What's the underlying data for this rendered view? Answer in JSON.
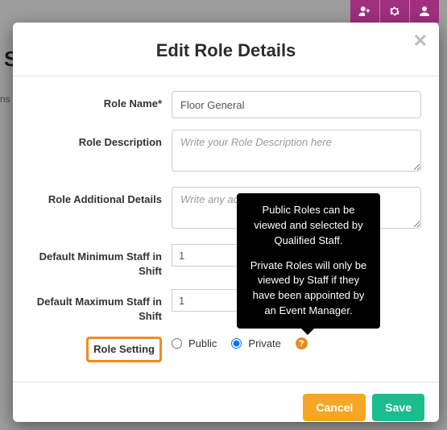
{
  "header": {
    "title": "Edit Role Details"
  },
  "fields": {
    "role_name": {
      "label": "Role Name*",
      "value": "Floor General"
    },
    "role_desc": {
      "label": "Role Description",
      "placeholder": "Write your Role Description here"
    },
    "role_add": {
      "label": "Role Additional Details",
      "placeholder": "Write any additional Role Description here"
    },
    "min_staff": {
      "label": "Default Minimum Staff in Shift",
      "value": "1"
    },
    "max_staff": {
      "label": "Default Maximum Staff in Shift",
      "value": "1"
    },
    "setting": {
      "label": "Role Setting",
      "public": "Public",
      "private": "Private"
    }
  },
  "tooltip": {
    "p1": "Public Roles can be viewed and selected by Qualified Staff.",
    "p2": "Private Roles will only be viewed by Staff if they have been appointed by an Event Manager."
  },
  "footer": {
    "cancel": "Cancel",
    "save": "Save"
  },
  "bg": {
    "letter": "S",
    "ns": "ns"
  }
}
